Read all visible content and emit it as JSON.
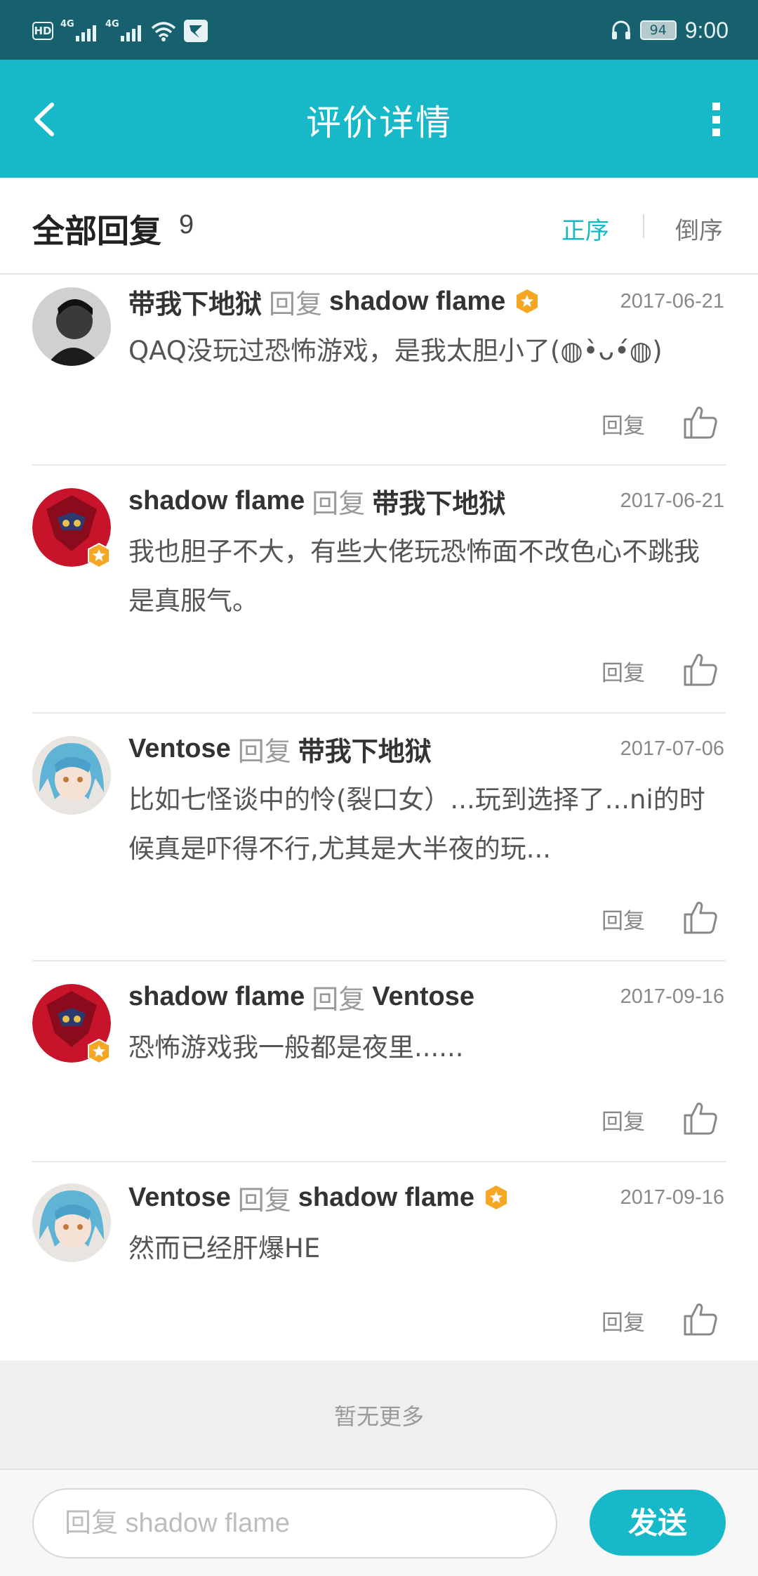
{
  "status_bar": {
    "hd": "HD",
    "signal1": "4G",
    "signal2": "4G",
    "battery": "94",
    "time": "9:00"
  },
  "app_bar": {
    "title": "评价详情",
    "back_icon": "chevron-left-icon",
    "more_icon": "more-vertical-icon"
  },
  "replies_header": {
    "title": "全部回复",
    "count": "9",
    "sort_asc": "正序",
    "sort_desc": "倒序",
    "active_sort": "正序"
  },
  "comments": [
    {
      "author": "带我下地狱",
      "verb": "回复",
      "target": "shadow flame",
      "target_badge": true,
      "avatar_badge": false,
      "date": "2017-06-21",
      "text": "QAQ没玩过恐怖游戏，是我太胆小了(◍•̀ᴗ•́◍)",
      "reply_label": "回复"
    },
    {
      "author": "shadow flame",
      "verb": "回复",
      "target": "带我下地狱",
      "target_badge": false,
      "avatar_badge": true,
      "date": "2017-06-21",
      "text": "我也胆子不大，有些大佬玩恐怖面不改色心不跳我是真服气。",
      "reply_label": "回复"
    },
    {
      "author": "Ventose",
      "verb": "回复",
      "target": "带我下地狱",
      "target_badge": false,
      "avatar_badge": false,
      "date": "2017-07-06",
      "text": "比如七怪谈中的怜(裂口女）...玩到选择了...ni的时候真是吓得不行,尤其是大半夜的玩...",
      "reply_label": "回复"
    },
    {
      "author": "shadow flame",
      "verb": "回复",
      "target": "Ventose",
      "target_badge": false,
      "avatar_badge": true,
      "date": "2017-09-16",
      "text": "恐怖游戏我一般都是夜里......",
      "reply_label": "回复"
    },
    {
      "author": "Ventose",
      "verb": "回复",
      "target": "shadow flame",
      "target_badge": true,
      "avatar_badge": false,
      "date": "2017-09-16",
      "text": "然而已经肝爆HE",
      "reply_label": "回复"
    }
  ],
  "footer": {
    "no_more": "暂无更多",
    "input_placeholder": "回复 shadow flame",
    "send_label": "发送"
  },
  "colors": {
    "status_bar": "#17606e",
    "accent": "#17b8c7",
    "badge": "#f5a623"
  }
}
